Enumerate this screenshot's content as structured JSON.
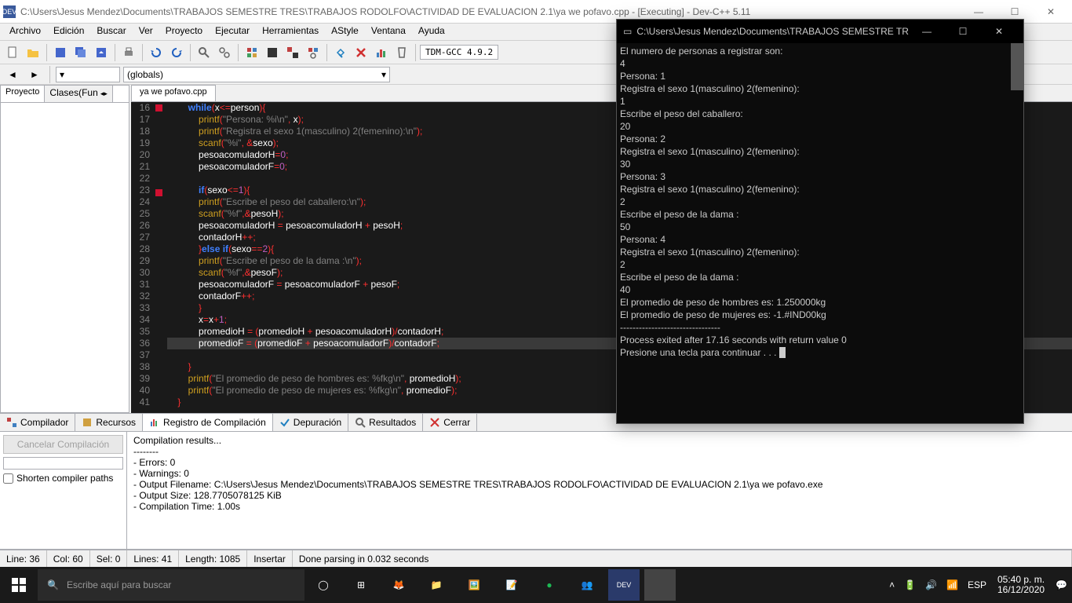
{
  "window": {
    "title": "C:\\Users\\Jesus Mendez\\Documents\\TRABAJOS SEMESTRE TRES\\TRABAJOS RODOLFO\\ACTIVIDAD DE EVALUACION 2.1\\ya we pofavo.cpp - [Executing] - Dev-C++ 5.11"
  },
  "menus": [
    "Archivo",
    "Edición",
    "Buscar",
    "Ver",
    "Proyecto",
    "Ejecutar",
    "Herramientas",
    "AStyle",
    "Ventana",
    "Ayuda"
  ],
  "compiler_combo": "TDM-GCC 4.9.2",
  "globals_combo": "(globals)",
  "left_tabs": {
    "proyecto": "Proyecto",
    "clases": "Clases(Fun"
  },
  "file_tab": "ya we pofavo.cpp",
  "code_lines": [
    {
      "n": 16,
      "html": "        <span class='kw'>while</span><span class='br'>(</span><span class='id'>x</span><span class='op'>&lt;=</span><span class='id'>person</span><span class='br'>){</span>"
    },
    {
      "n": 17,
      "html": "            <span class='fn'>printf</span><span class='br'>(</span><span class='str'>\"Persona: %i\\n\"</span><span class='op'>,</span> <span class='id'>x</span><span class='br'>)</span><span class='op'>;</span>"
    },
    {
      "n": 18,
      "html": "            <span class='fn'>printf</span><span class='br'>(</span><span class='str'>\"Registra el sexo 1(masculino) 2(femenino):\\n\"</span><span class='br'>)</span><span class='op'>;</span>"
    },
    {
      "n": 19,
      "html": "            <span class='fn'>scanf</span><span class='br'>(</span><span class='str'>\"%i\"</span><span class='op'>,</span> <span class='op'>&amp;</span><span class='id'>sexo</span><span class='br'>)</span><span class='op'>;</span>"
    },
    {
      "n": 20,
      "html": "            <span class='id'>pesoacomuladorH</span><span class='op'>=</span><span class='num'>0</span><span class='op'>;</span>"
    },
    {
      "n": 21,
      "html": "            <span class='id'>pesoacomuladorF</span><span class='op'>=</span><span class='num'>0</span><span class='op'>;</span>"
    },
    {
      "n": 22,
      "html": ""
    },
    {
      "n": 23,
      "html": "            <span class='kw'>if</span><span class='br'>(</span><span class='id'>sexo</span><span class='op'>&lt;=</span><span class='num'>1</span><span class='br'>){</span>"
    },
    {
      "n": 24,
      "html": "            <span class='fn'>printf</span><span class='br'>(</span><span class='str'>\"Escribe el peso del caballero:\\n\"</span><span class='br'>)</span><span class='op'>;</span>"
    },
    {
      "n": 25,
      "html": "            <span class='fn'>scanf</span><span class='br'>(</span><span class='str'>\"%f\"</span><span class='op'>,&amp;</span><span class='id'>pesoH</span><span class='br'>)</span><span class='op'>;</span>"
    },
    {
      "n": 26,
      "html": "            <span class='id'>pesoacomuladorH</span> <span class='op'>=</span> <span class='id'>pesoacomuladorH</span> <span class='op'>+</span> <span class='id'>pesoH</span><span class='op'>;</span>"
    },
    {
      "n": 27,
      "html": "            <span class='id'>contadorH</span><span class='op'>++;</span>"
    },
    {
      "n": 28,
      "html": "            <span class='br'>}</span><span class='kw'>else if</span><span class='br'>(</span><span class='id'>sexo</span><span class='op'>==</span><span class='num'>2</span><span class='br'>){</span>"
    },
    {
      "n": 29,
      "html": "            <span class='fn'>printf</span><span class='br'>(</span><span class='str'>\"Escribe el peso de la dama :\\n\"</span><span class='br'>)</span><span class='op'>;</span>"
    },
    {
      "n": 30,
      "html": "            <span class='fn'>scanf</span><span class='br'>(</span><span class='str'>\"%f\"</span><span class='op'>,&amp;</span><span class='id'>pesoF</span><span class='br'>)</span><span class='op'>;</span>"
    },
    {
      "n": 31,
      "html": "            <span class='id'>pesoacomuladorF</span> <span class='op'>=</span> <span class='id'>pesoacomuladorF</span> <span class='op'>+</span> <span class='id'>pesoF</span><span class='op'>;</span>"
    },
    {
      "n": 32,
      "html": "            <span class='id'>contadorF</span><span class='op'>++;</span>"
    },
    {
      "n": 33,
      "html": "            <span class='br'>}</span>"
    },
    {
      "n": 34,
      "html": "            <span class='id'>x</span><span class='op'>=</span><span class='id'>x</span><span class='op'>+</span><span class='num'>1</span><span class='op'>;</span>"
    },
    {
      "n": 35,
      "html": "            <span class='id'>promedioH</span> <span class='op'>=</span> <span class='br'>(</span><span class='id'>promedioH</span> <span class='op'>+</span> <span class='id'>pesoacomuladorH</span><span class='br'>)</span><span class='op'>/</span><span class='id'>contadorH</span><span class='op'>;</span>"
    },
    {
      "n": 36,
      "html": "            <span class='id'>promedioF</span> <span class='op'>=</span> <span class='br'>(</span><span class='id'>promedioF</span> <span class='op'>+</span> <span class='id'>pesoacomuladorF</span><span class='br'>)</span><span class='op'>/</span><span class='id'>contadorF</span><span class='op'>;</span>",
      "hl": true
    },
    {
      "n": 37,
      "html": ""
    },
    {
      "n": 38,
      "html": "        <span class='br'>}</span>"
    },
    {
      "n": 39,
      "html": "        <span class='fn'>printf</span><span class='br'>(</span><span class='str'>\"El promedio de peso de hombres es: %fkg\\n\"</span><span class='op'>,</span> <span class='id'>promedioH</span><span class='br'>)</span><span class='op'>;</span>"
    },
    {
      "n": 40,
      "html": "        <span class='fn'>printf</span><span class='br'>(</span><span class='str'>\"El promedio de peso de mujeres es: %fkg\\n\"</span><span class='op'>,</span> <span class='id'>promedioF</span><span class='br'>)</span><span class='op'>;</span>"
    },
    {
      "n": 41,
      "html": "    <span class='br'>}</span>"
    }
  ],
  "bottom_tabs": {
    "compilador": "Compilador",
    "recursos": "Recursos",
    "registro": "Registro de Compilación",
    "depuracion": "Depuración",
    "resultados": "Resultados",
    "cerrar": "Cerrar"
  },
  "cancel_label": "Cancelar Compilación",
  "shorten_label": "Shorten compiler paths",
  "compilation_output": [
    "Compilation results...",
    "--------",
    "- Errors: 0",
    "- Warnings: 0",
    "- Output Filename: C:\\Users\\Jesus Mendez\\Documents\\TRABAJOS SEMESTRE TRES\\TRABAJOS RODOLFO\\ACTIVIDAD DE EVALUACION 2.1\\ya we pofavo.exe",
    "- Output Size: 128.7705078125 KiB",
    "- Compilation Time: 1.00s"
  ],
  "status": {
    "line": "Line:   36",
    "col": "Col:   60",
    "sel": "Sel:   0",
    "lines": "Lines:   41",
    "length": "Length:   1085",
    "mode": "Insertar",
    "msg": "Done parsing in 0.032 seconds"
  },
  "console": {
    "title": "C:\\Users\\Jesus Mendez\\Documents\\TRABAJOS SEMESTRE TRES\\T...",
    "lines": [
      "El numero de personas a registrar son:",
      "4",
      "Persona: 1",
      "Registra el sexo 1(masculino) 2(femenino):",
      "1",
      "Escribe el peso del caballero:",
      "20",
      "Persona: 2",
      "Registra el sexo 1(masculino) 2(femenino):",
      "30",
      "Persona: 3",
      "Registra el sexo 1(masculino) 2(femenino):",
      "2",
      "Escribe el peso de la dama :",
      "50",
      "Persona: 4",
      "Registra el sexo 1(masculino) 2(femenino):",
      "2",
      "Escribe el peso de la dama :",
      "40",
      "El promedio de peso de hombres es: 1.250000kg",
      "El promedio de peso de mujeres es: -1.#IND00kg",
      "",
      "--------------------------------",
      "Process exited after 17.16 seconds with return value 0",
      "Presione una tecla para continuar . . . "
    ]
  },
  "taskbar": {
    "search_placeholder": "Escribe aquí para buscar",
    "lang": "ESP",
    "time": "05:40 p. m.",
    "date": "16/12/2020"
  }
}
